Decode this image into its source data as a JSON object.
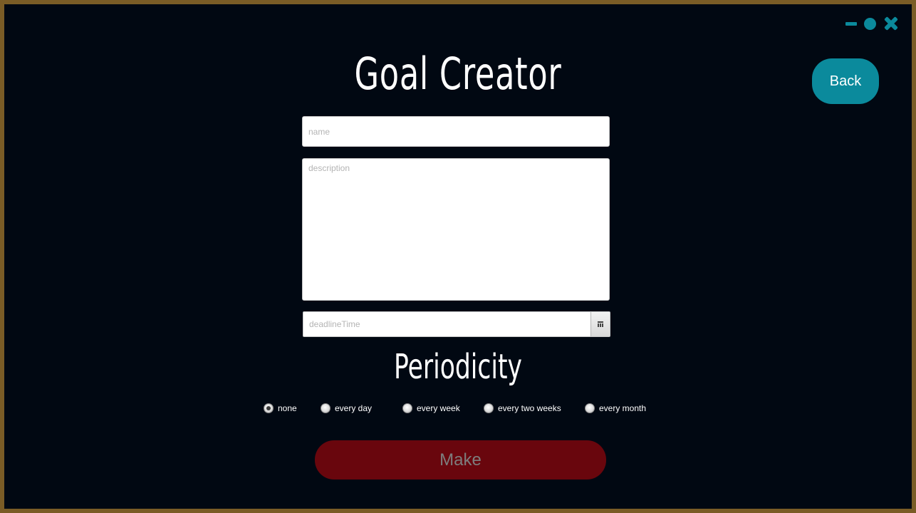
{
  "window": {
    "controls": [
      "minimize-icon",
      "maximize-icon",
      "close-icon"
    ],
    "accent_color": "#0b8a9c",
    "frame_color": "#7a5c26",
    "background_color": "#010812"
  },
  "header": {
    "title": "Goal Creator",
    "back_label": "Back"
  },
  "form": {
    "name_placeholder": "name",
    "description_placeholder": "description",
    "deadline_placeholder": "deadlineTime"
  },
  "periodicity": {
    "title": "Periodicity",
    "options": [
      {
        "label": "none",
        "selected": true
      },
      {
        "label": "every day",
        "selected": false
      },
      {
        "label": "every week",
        "selected": false
      },
      {
        "label": "every two weeks",
        "selected": false
      },
      {
        "label": "every month",
        "selected": false
      }
    ]
  },
  "actions": {
    "make_label": "Make",
    "make_color": "#69060d"
  }
}
